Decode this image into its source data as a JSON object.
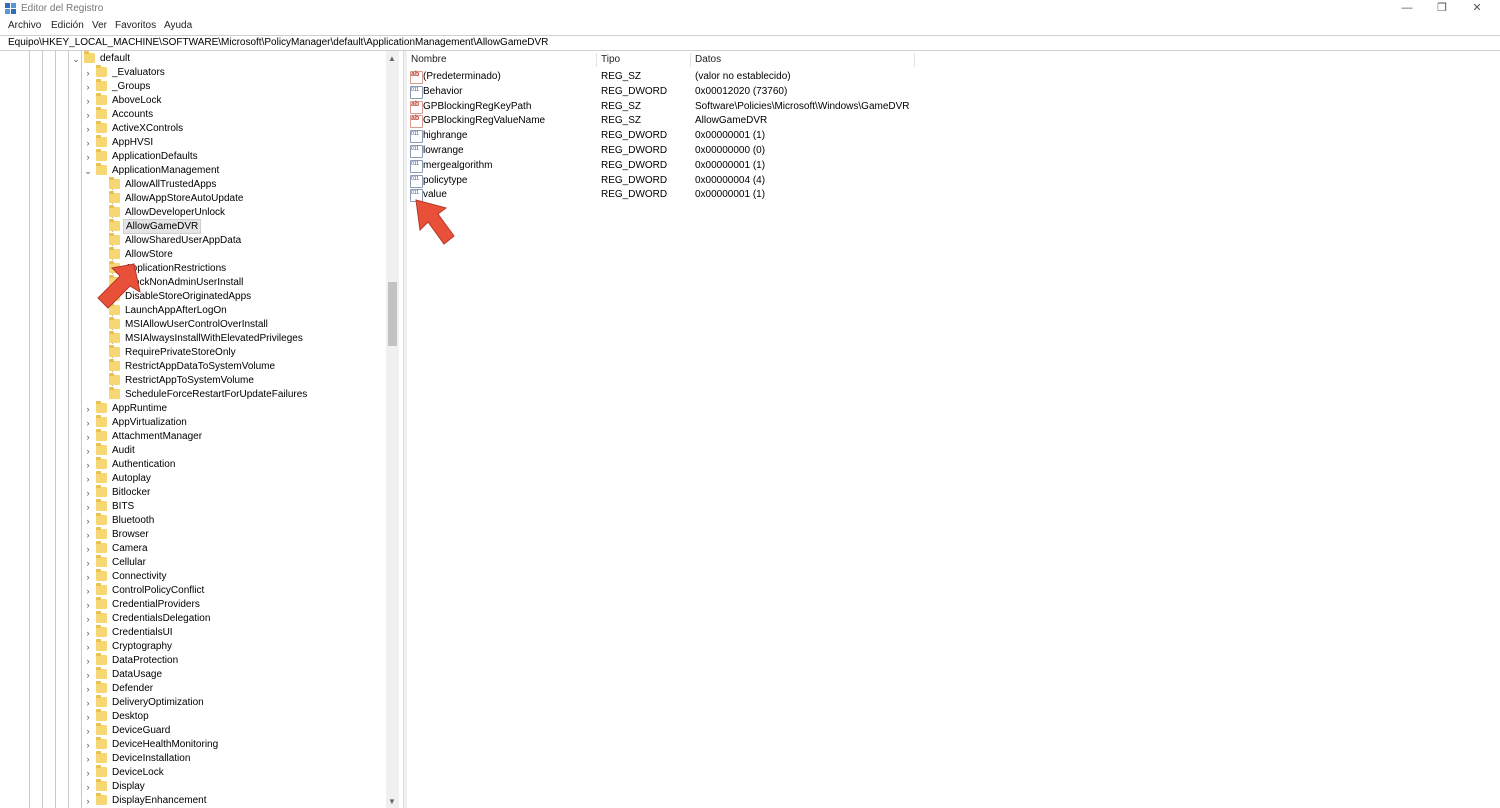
{
  "window": {
    "title": "Editor del Registro",
    "controls": {
      "minimize": "—",
      "maximize": "❐",
      "close": "✕"
    }
  },
  "menu": [
    "Archivo",
    "Edición",
    "Ver",
    "Favoritos",
    "Ayuda"
  ],
  "address": "Equipo\\HKEY_LOCAL_MACHINE\\SOFTWARE\\Microsoft\\PolicyManager\\default\\ApplicationManagement\\AllowGameDVR",
  "tree": {
    "root": "default",
    "items": [
      "_Evaluators",
      "_Groups",
      "AboveLock",
      "Accounts",
      "ActiveXControls",
      "AppHVSI",
      "ApplicationDefaults",
      "ApplicationManagement"
    ],
    "subitems": [
      "AllowAllTrustedApps",
      "AllowAppStoreAutoUpdate",
      "AllowDeveloperUnlock",
      "AllowGameDVR",
      "AllowSharedUserAppData",
      "AllowStore",
      "ApplicationRestrictions",
      "BlockNonAdminUserInstall",
      "DisableStoreOriginatedApps",
      "LaunchAppAfterLogOn",
      "MSIAllowUserControlOverInstall",
      "MSIAlwaysInstallWithElevatedPrivileges",
      "RequirePrivateStoreOnly",
      "RestrictAppDataToSystemVolume",
      "RestrictAppToSystemVolume",
      "ScheduleForceRestartForUpdateFailures"
    ],
    "selected": "AllowGameDVR",
    "items_after": [
      "AppRuntime",
      "AppVirtualization",
      "AttachmentManager",
      "Audit",
      "Authentication",
      "Autoplay",
      "Bitlocker",
      "BITS",
      "Bluetooth",
      "Browser",
      "Camera",
      "Cellular",
      "Connectivity",
      "ControlPolicyConflict",
      "CredentialProviders",
      "CredentialsDelegation",
      "CredentialsUI",
      "Cryptography",
      "DataProtection",
      "DataUsage",
      "Defender",
      "DeliveryOptimization",
      "Desktop",
      "DeviceGuard",
      "DeviceHealthMonitoring",
      "DeviceInstallation",
      "DeviceLock",
      "Display",
      "DisplayEnhancement"
    ]
  },
  "list": {
    "columns": [
      "Nombre",
      "Tipo",
      "Datos"
    ],
    "rows": [
      {
        "name": "(Predeterminado)",
        "type": "REG_SZ",
        "data": "(valor no establecido)",
        "icon": "string-value-icon"
      },
      {
        "name": "Behavior",
        "type": "REG_DWORD",
        "data": "0x00012020 (73760)",
        "icon": "dword-value-icon"
      },
      {
        "name": "GPBlockingRegKeyPath",
        "type": "REG_SZ",
        "data": "Software\\Policies\\Microsoft\\Windows\\GameDVR",
        "icon": "string-value-icon"
      },
      {
        "name": "GPBlockingRegValueName",
        "type": "REG_SZ",
        "data": "AllowGameDVR",
        "icon": "string-value-icon"
      },
      {
        "name": "highrange",
        "type": "REG_DWORD",
        "data": "0x00000001 (1)",
        "icon": "dword-value-icon"
      },
      {
        "name": "lowrange",
        "type": "REG_DWORD",
        "data": "0x00000000 (0)",
        "icon": "dword-value-icon"
      },
      {
        "name": "mergealgorithm",
        "type": "REG_DWORD",
        "data": "0x00000001 (1)",
        "icon": "dword-value-icon"
      },
      {
        "name": "policytype",
        "type": "REG_DWORD",
        "data": "0x00000004 (4)",
        "icon": "dword-value-icon"
      },
      {
        "name": "value",
        "type": "REG_DWORD",
        "data": "0x00000001 (1)",
        "icon": "dword-value-icon"
      }
    ]
  },
  "colors": {
    "folder": "#f7d774",
    "arrow": "#e8503a",
    "selection": "#e5e5e5"
  }
}
